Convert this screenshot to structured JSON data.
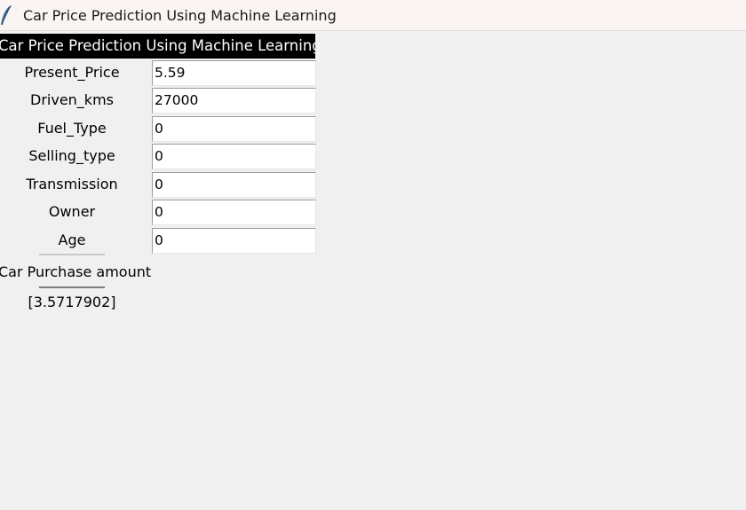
{
  "window": {
    "title": "Car Price Prediction Using Machine Learning",
    "icon": "feather-icon"
  },
  "header": {
    "text": "Car Price Prediction Using Machine Learning",
    "background": "#000000",
    "color": "#ffffff"
  },
  "fields": [
    {
      "label": "Present_Price",
      "value": "5.59"
    },
    {
      "label": "Driven_kms",
      "value": "27000"
    },
    {
      "label": "Fuel_Type",
      "value": "0"
    },
    {
      "label": "Selling_type",
      "value": "0"
    },
    {
      "label": "Transmission",
      "value": "0"
    },
    {
      "label": "Owner",
      "value": "0"
    },
    {
      "label": "Age",
      "value": "0"
    }
  ],
  "predict_button": {
    "label": "Car Purchase amount"
  },
  "result": {
    "text": "[3.5717902]"
  }
}
